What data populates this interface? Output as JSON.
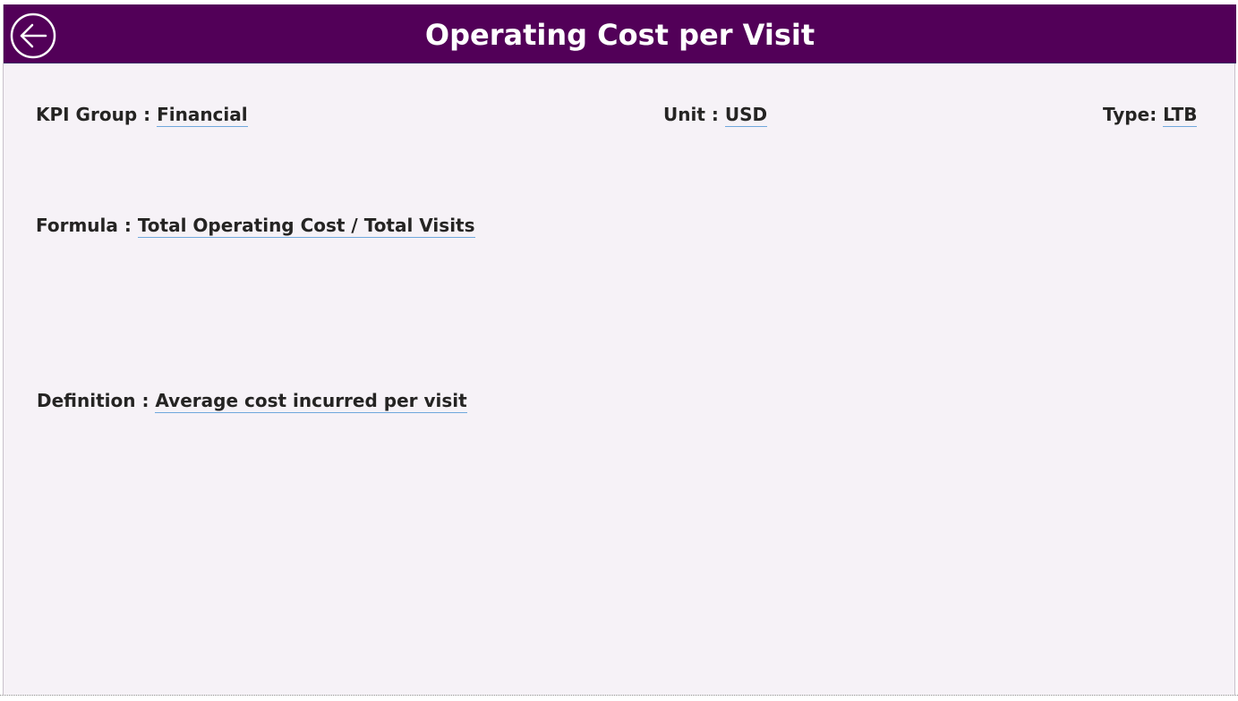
{
  "header": {
    "title": "Operating Cost per Visit",
    "back_icon": "arrow-left-circle-icon",
    "background_color": "#520058"
  },
  "kpi_group": {
    "label": "KPI Group : ",
    "value": "Financial"
  },
  "unit": {
    "label": "Unit : ",
    "value": "USD"
  },
  "type": {
    "label": "Type: ",
    "value": "LTB"
  },
  "formula": {
    "label": "Formula : ",
    "value": "Total Operating Cost / Total Visits"
  },
  "definition": {
    "label": "Definition : ",
    "value": "Average cost incurred per visit"
  },
  "colors": {
    "page_background": "#f6f2f7",
    "text": "#252423",
    "value_underline": "#6fa8dc"
  }
}
